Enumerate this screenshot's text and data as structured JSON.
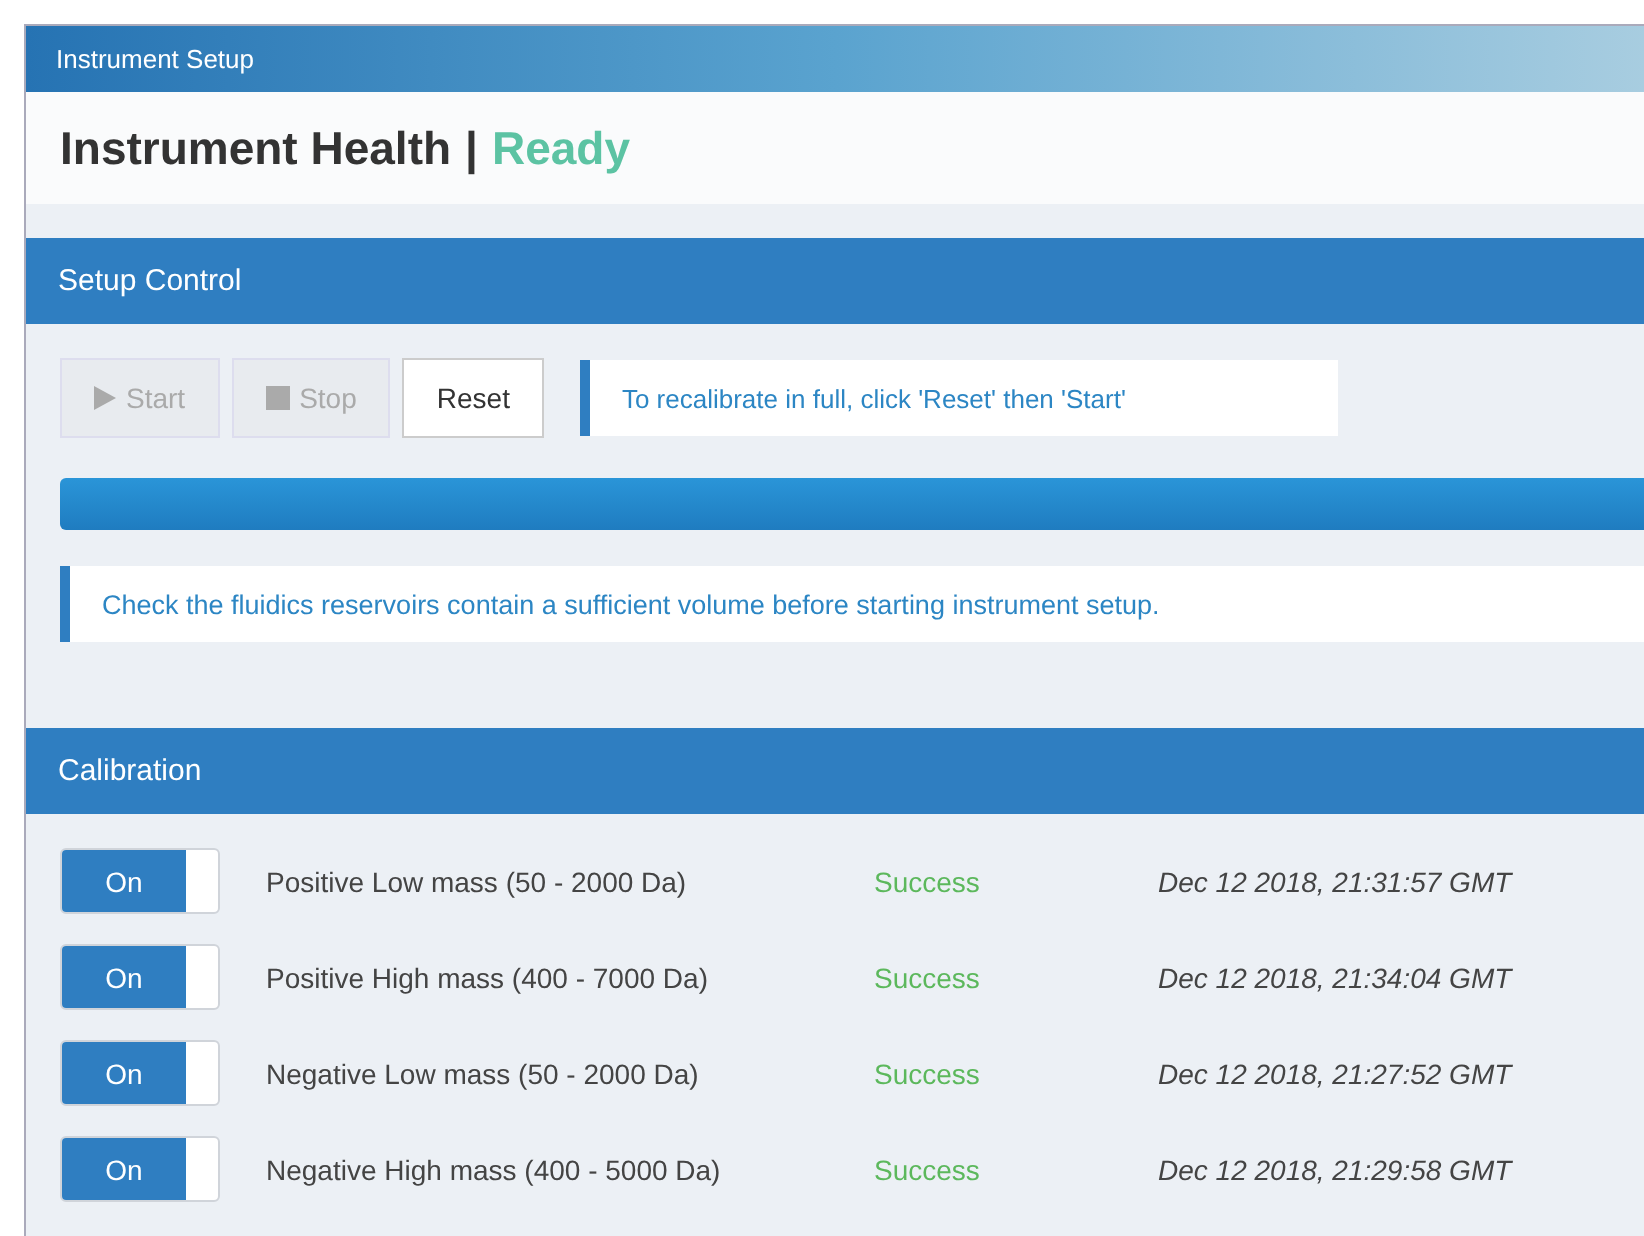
{
  "window": {
    "title": "Instrument Setup"
  },
  "header": {
    "title": "Instrument Health",
    "separator": "|",
    "status": "Ready"
  },
  "setup_control": {
    "title": "Setup Control",
    "buttons": [
      {
        "kind": "play",
        "label": "Start",
        "disabled": true
      },
      {
        "kind": "stop",
        "label": "Stop",
        "disabled": true
      },
      {
        "kind": "plain",
        "label": "Reset",
        "disabled": false
      }
    ],
    "hint": "To recalibrate in full, click 'Reset' then 'Start'",
    "progress": {
      "level": 1
    },
    "notice": "Check the fluidics reservoirs contain a sufficient volume before starting instrument setup."
  },
  "calibration": {
    "title": "Calibration",
    "rows": [
      {
        "toggle": "On",
        "on": true,
        "name": "Positive Low mass (50 - 2000 Da)",
        "status": "Success",
        "time": "Dec 12 2018, 21:31:57 GMT"
      },
      {
        "toggle": "On",
        "on": true,
        "name": "Positive High mass (400 - 7000 Da)",
        "status": "Success",
        "time": "Dec 12 2018, 21:34:04 GMT"
      },
      {
        "toggle": "On",
        "on": true,
        "name": "Negative Low mass (50 - 2000 Da)",
        "status": "Success",
        "time": "Dec 12 2018, 21:27:52 GMT"
      },
      {
        "toggle": "On",
        "on": true,
        "name": "Negative High mass (400 - 5000 Da)",
        "status": "Success",
        "time": "Dec 12 2018, 21:29:58 GMT"
      }
    ]
  }
}
